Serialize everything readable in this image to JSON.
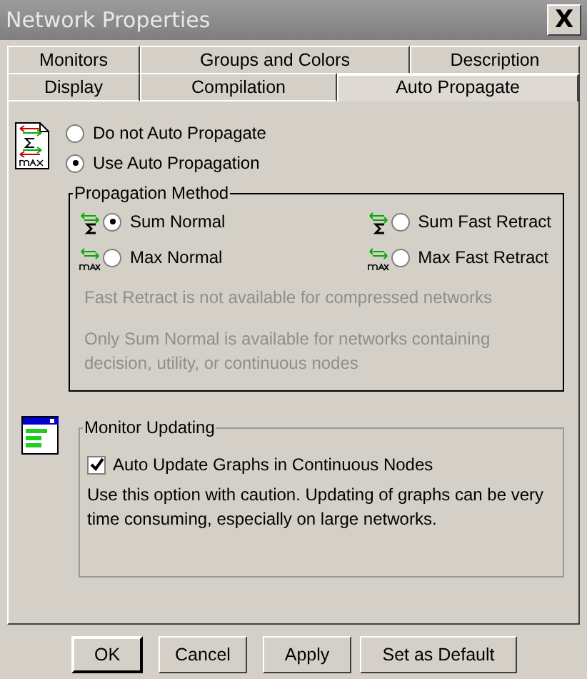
{
  "window": {
    "title": "Network Properties",
    "close": "X"
  },
  "tab_rows": [
    [
      {
        "label": "Monitors",
        "selected": false
      },
      {
        "label": "Groups and Colors",
        "selected": false
      },
      {
        "label": "Description",
        "selected": false
      }
    ],
    [
      {
        "label": "Display",
        "selected": false
      },
      {
        "label": "Compilation",
        "selected": false
      },
      {
        "label": "Auto Propagate",
        "selected": true
      }
    ]
  ],
  "auto_propagation": [
    {
      "label": "Do not Auto Propagate",
      "selected": false
    },
    {
      "label": "Use Auto Propagation",
      "selected": true
    }
  ],
  "propagation_method": {
    "title": "Propagation Method",
    "options": [
      {
        "label": "Sum Normal",
        "kind": "sum",
        "selected": true
      },
      {
        "label": "Sum Fast Retract",
        "kind": "sum",
        "selected": false
      },
      {
        "label": "Max Normal",
        "kind": "max",
        "selected": false
      },
      {
        "label": "Max Fast Retract",
        "kind": "max",
        "selected": false
      }
    ],
    "notes": [
      {
        "text": "Fast Retract is not available for compressed networks",
        "disabled": true
      },
      {
        "text": "Only Sum Normal is available for networks containing decision, utility, or continuous nodes",
        "disabled": true
      }
    ]
  },
  "monitor_updating": {
    "title": "Monitor Updating",
    "checkbox": {
      "label": "Auto Update Graphs in Continuous Nodes",
      "checked": true
    },
    "note": "Use this option with caution. Updating of graphs can be very time consuming, especially on large networks."
  },
  "buttons": [
    "OK",
    "Cancel",
    "Apply",
    "Set as Default"
  ]
}
